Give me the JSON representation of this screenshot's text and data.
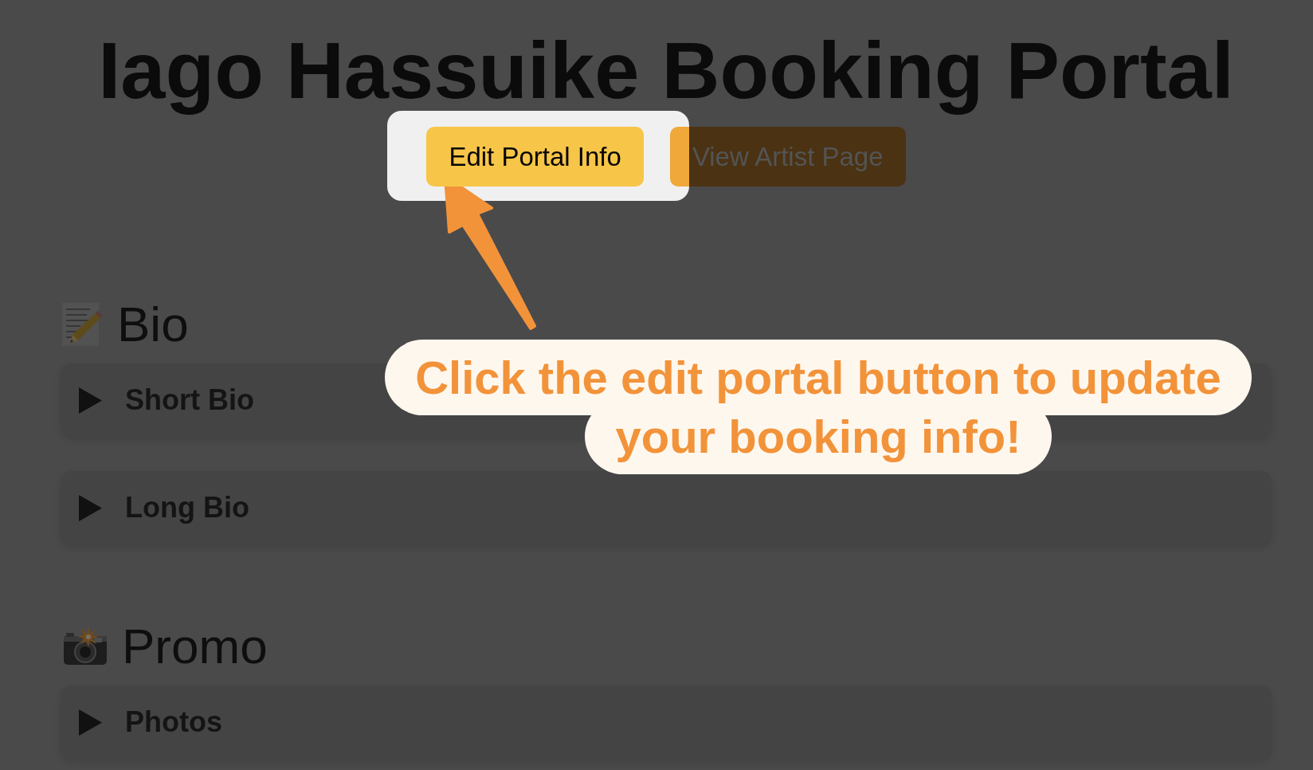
{
  "title": "Iago Hassuike Booking Portal",
  "actions": [
    {
      "label": "Edit Portal Info",
      "highlighted": true
    },
    {
      "label": "View Artist Page",
      "highlighted": false
    }
  ],
  "sections": [
    {
      "heading": "Bio",
      "items": [
        {
          "label": "Short Bio",
          "expanded": false
        },
        {
          "label": "Long Bio",
          "expanded": false
        }
      ]
    },
    {
      "heading": "Promo",
      "items": [
        {
          "label": "Photos",
          "expanded": false
        }
      ]
    }
  ],
  "tooltip": {
    "text": "Click the edit portal button to update your booking info!"
  }
}
